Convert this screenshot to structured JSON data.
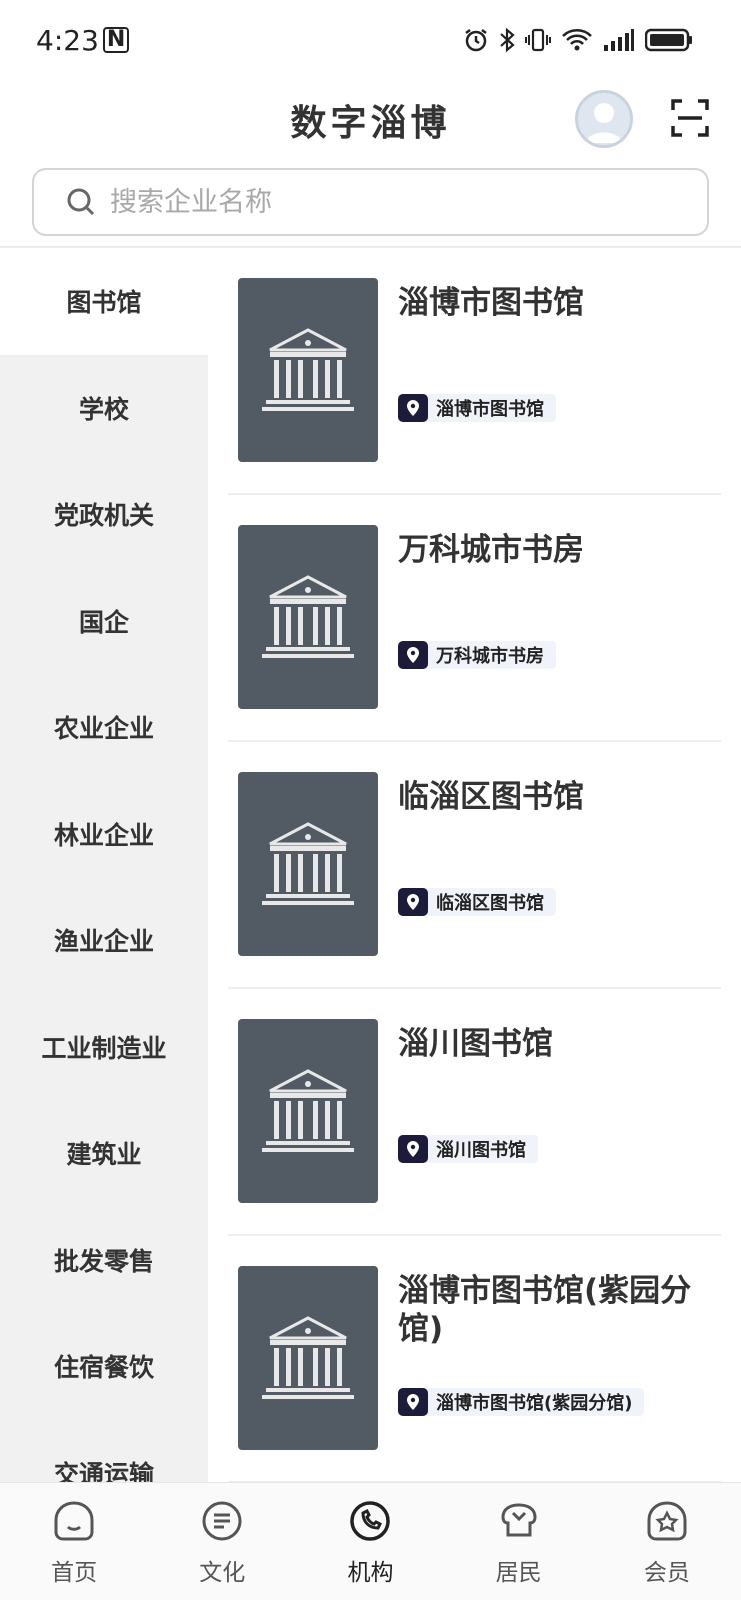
{
  "status_bar": {
    "time": "4:23",
    "nfc": "N"
  },
  "header": {
    "title": "数字淄博"
  },
  "search": {
    "placeholder": "搜索企业名称"
  },
  "sidebar": {
    "items": [
      {
        "label": "图书馆",
        "active": true
      },
      {
        "label": "学校"
      },
      {
        "label": "党政机关"
      },
      {
        "label": "国企"
      },
      {
        "label": "农业企业"
      },
      {
        "label": "林业企业"
      },
      {
        "label": "渔业企业"
      },
      {
        "label": "工业制造业"
      },
      {
        "label": "建筑业"
      },
      {
        "label": "批发零售"
      },
      {
        "label": "住宿餐饮"
      },
      {
        "label": "交通运输"
      }
    ]
  },
  "cards": [
    {
      "name": "淄博市图书馆",
      "tag": "淄博市图书馆"
    },
    {
      "name": "万科城市书房",
      "tag": "万科城市书房"
    },
    {
      "name": "临淄区图书馆",
      "tag": "临淄区图书馆"
    },
    {
      "name": "淄川图书馆",
      "tag": "淄川图书馆"
    },
    {
      "name": "淄博市图书馆(紫园分馆)",
      "tag": "淄博市图书馆(紫园分馆)"
    }
  ],
  "tabbar": {
    "tabs": [
      {
        "label": "首页",
        "icon": "home-icon"
      },
      {
        "label": "文化",
        "icon": "culture-icon"
      },
      {
        "label": "机构",
        "icon": "institution-icon",
        "active": true
      },
      {
        "label": "居民",
        "icon": "resident-icon"
      },
      {
        "label": "会员",
        "icon": "member-icon"
      }
    ]
  }
}
